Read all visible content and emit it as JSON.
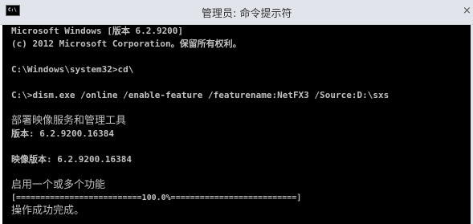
{
  "window": {
    "title": "管理员: 命令提示符",
    "icon_label": "C:\\"
  },
  "console": {
    "lines": [
      "Microsoft Windows [版本 6.2.9200]",
      "(c) 2012 Microsoft Corporation。保留所有权利。",
      "",
      "C:\\Windows\\system32>cd\\",
      "",
      "C:\\>dism.exe /online /enable-feature /featurename:NetFX3 /Source:D:\\sxs",
      "",
      "部署映像服务和管理工具",
      "版本: 6.2.9200.16384",
      "",
      "映像版本: 6.2.9200.16384",
      "",
      "启用一个或多个功能",
      "[==========================100.0%==========================]",
      "操作成功完成。"
    ]
  },
  "colors": {
    "console_bg": "#000000",
    "console_text": "#c0c0c0",
    "titlebar_bg": "#e1e4ea"
  }
}
